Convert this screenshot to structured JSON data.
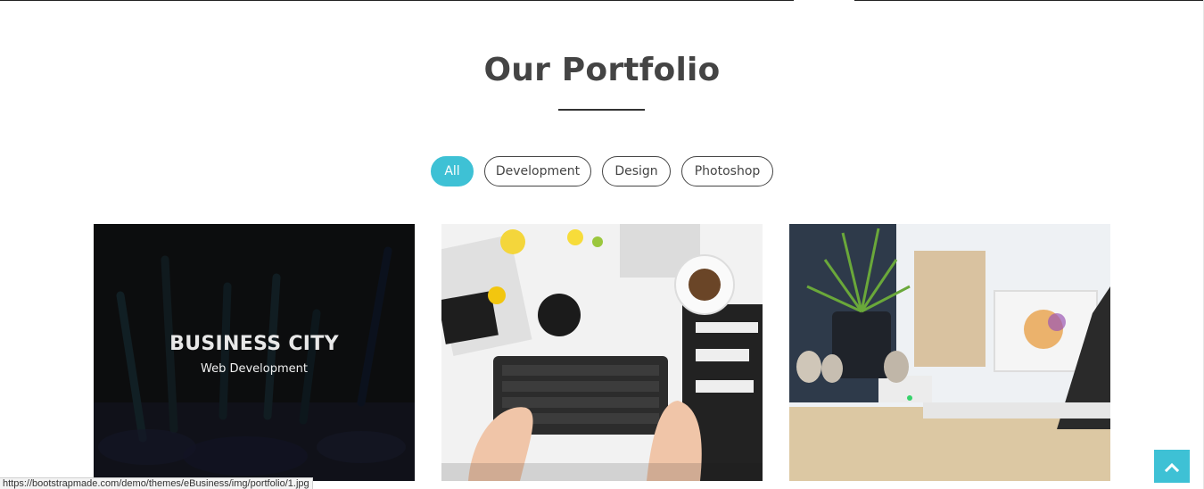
{
  "section": {
    "title": "Our Portfolio"
  },
  "filters": [
    {
      "label": "All",
      "active": true
    },
    {
      "label": "Development",
      "active": false
    },
    {
      "label": "Design",
      "active": false
    },
    {
      "label": "Photoshop",
      "active": false
    }
  ],
  "portfolio": {
    "items": [
      {
        "title": "BUSINESS CITY",
        "category": "Web Development",
        "hovered": true
      },
      {
        "hovered": false
      },
      {
        "hovered": false
      }
    ]
  },
  "status_bar": {
    "url": "https://bootstrapmade.com/demo/themes/eBusiness/img/portfolio/1.jpg"
  },
  "back_to_top": {
    "icon": "chevron-up-icon"
  },
  "colors": {
    "accent": "#3ec1d5",
    "heading": "#444444",
    "overlay": "rgba(0,0,0,0.72)"
  }
}
